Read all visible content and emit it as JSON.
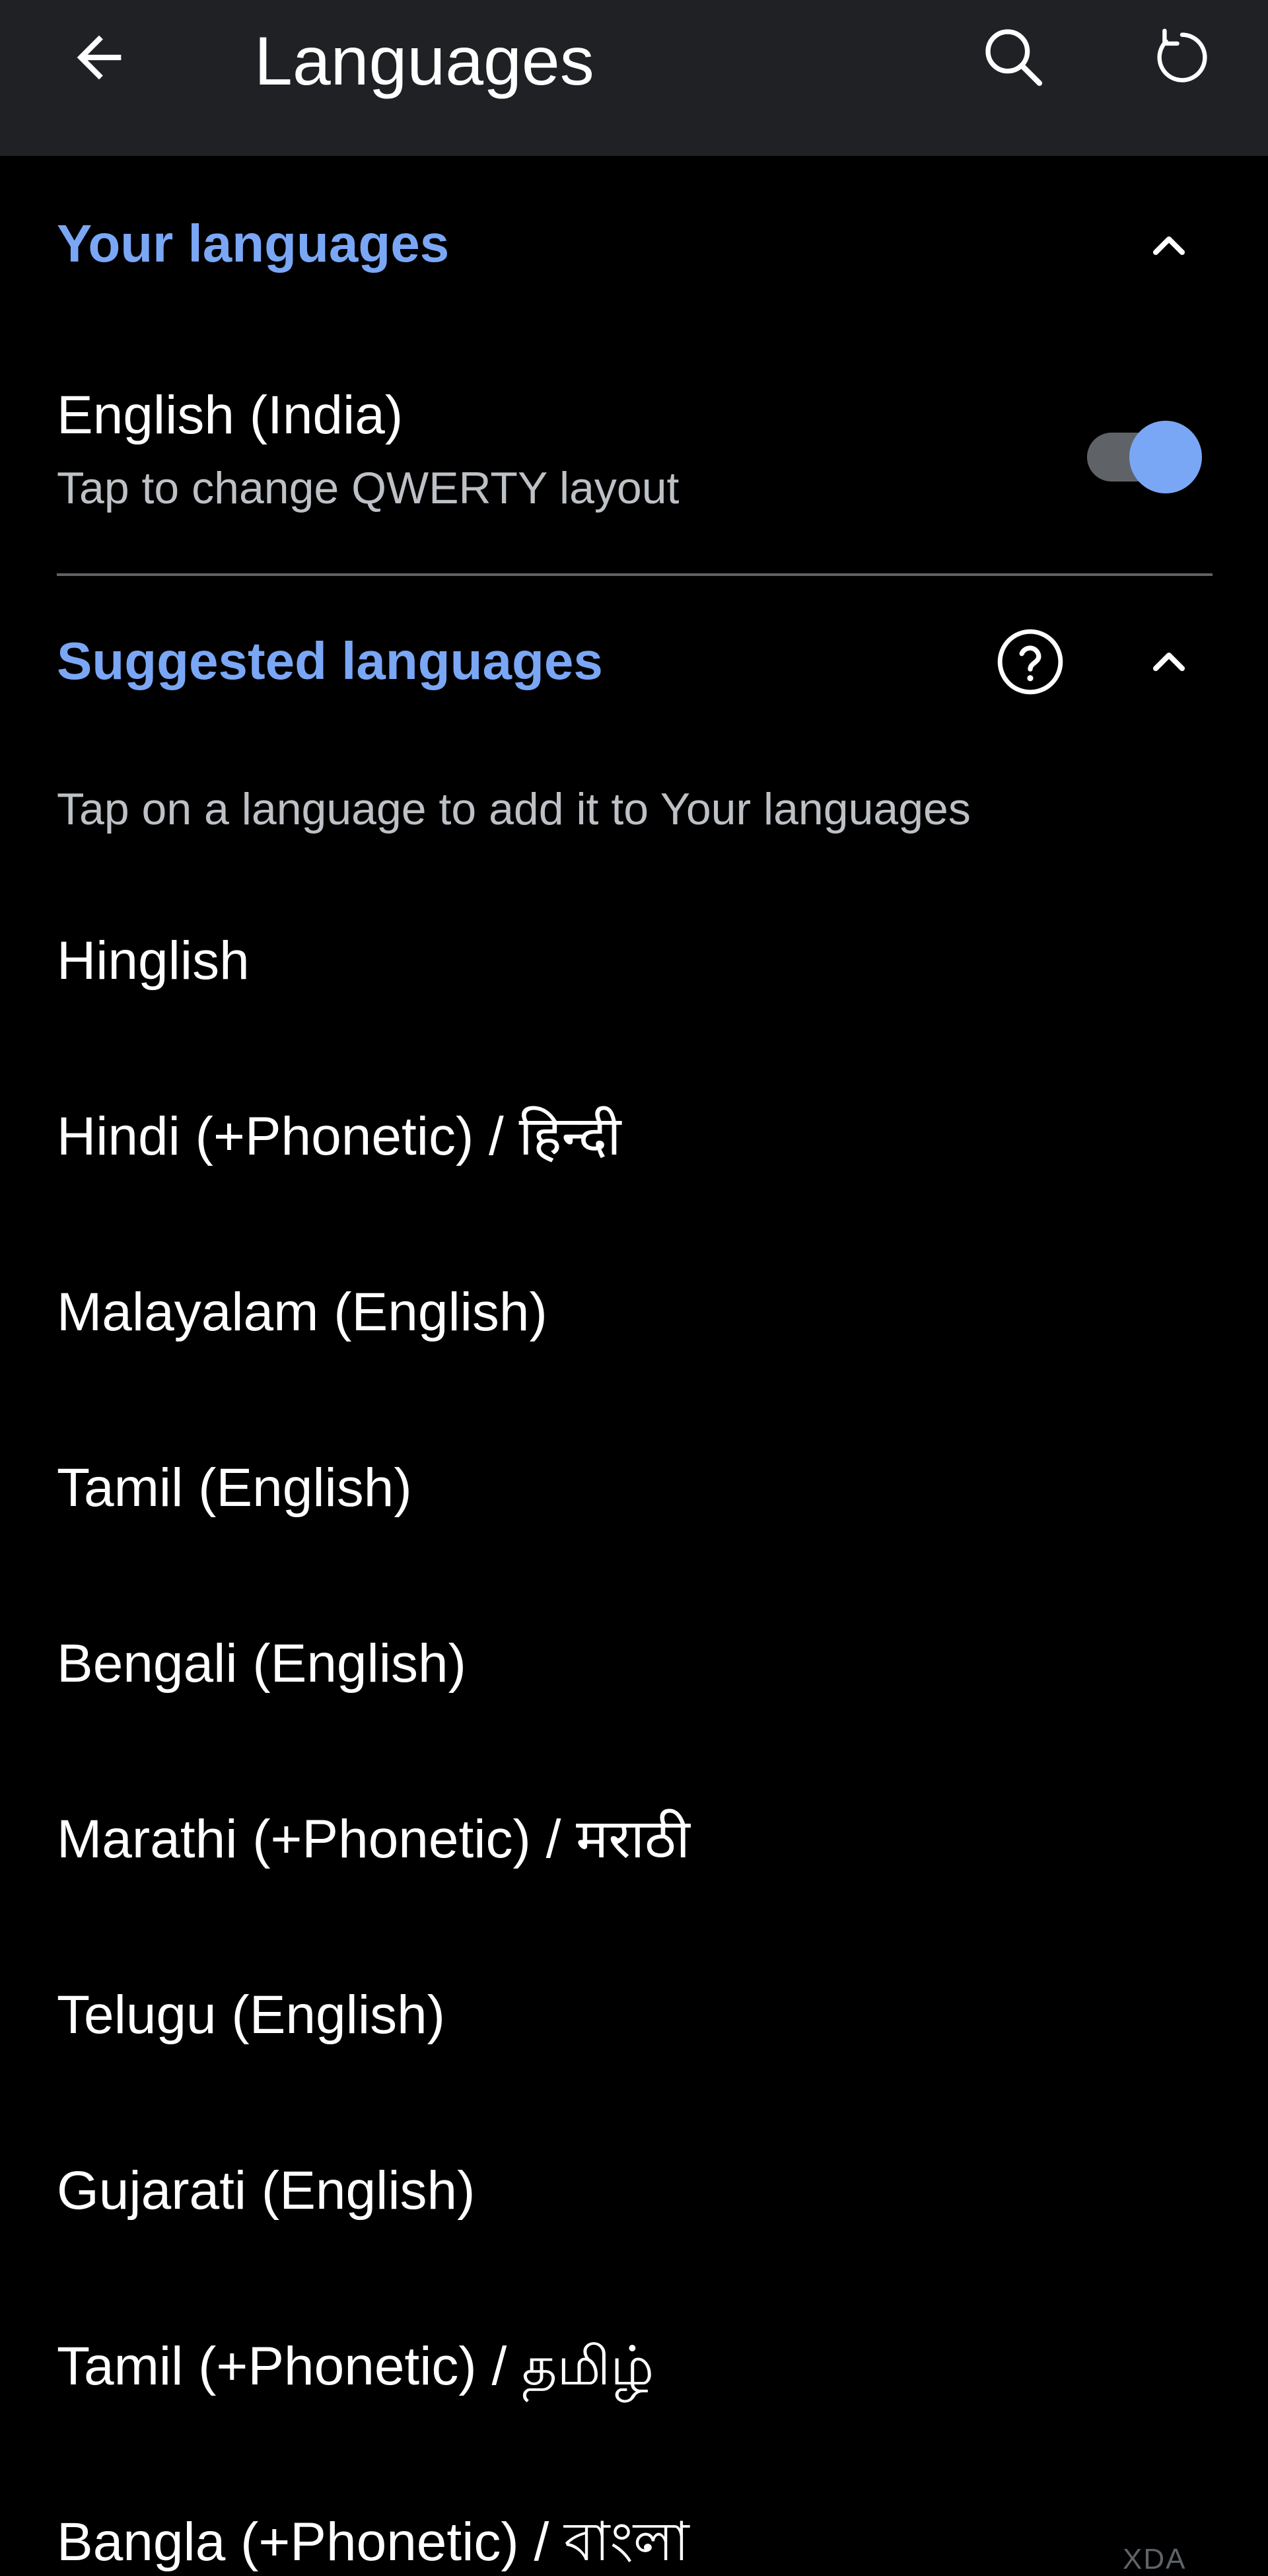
{
  "appbar": {
    "title": "Languages",
    "back_icon": "arrow-back-icon",
    "search_icon": "search-icon",
    "refresh_icon": "refresh-icon"
  },
  "your_languages": {
    "title": "Your languages",
    "items": [
      {
        "name": "English (India)",
        "subtitle": "Tap to change QWERTY layout",
        "enabled": true
      }
    ]
  },
  "suggested_languages": {
    "title": "Suggested languages",
    "hint": "Tap on a language to add it to Your languages",
    "items": [
      {
        "name": "Hinglish"
      },
      {
        "name": "Hindi (+Phonetic) / हिन्दी"
      },
      {
        "name": "Malayalam (English)"
      },
      {
        "name": "Tamil (English)"
      },
      {
        "name": "Bengali (English)"
      },
      {
        "name": "Marathi (+Phonetic) / मराठी"
      },
      {
        "name": "Telugu (English)"
      },
      {
        "name": "Gujarati (English)"
      },
      {
        "name": "Tamil (+Phonetic) / தமிழ்"
      },
      {
        "name": "Bangla (+Phonetic) / বাংলা"
      }
    ]
  },
  "watermark": "XDA",
  "colors": {
    "accent": "#7aa7f5",
    "appbar_bg": "#202124",
    "background": "#000000",
    "secondary_text": "#bdc1c6"
  }
}
